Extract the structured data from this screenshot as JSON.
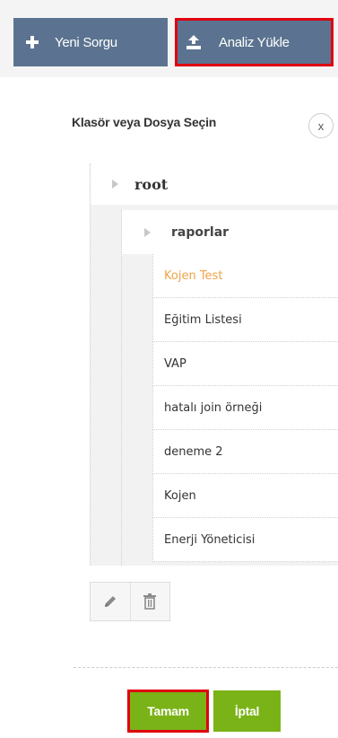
{
  "toolbar": {
    "new_query_label": "Yeni Sorgu",
    "upload_analysis_label": "Analiz Yükle"
  },
  "dialog": {
    "title": "Klasör veya Dosya Seçin",
    "close_label": "x"
  },
  "tree": {
    "root": {
      "label": "root"
    },
    "folder": {
      "label": "raporlar"
    },
    "files": [
      {
        "label": "Kojen Test",
        "selected": true
      },
      {
        "label": "Eğitim Listesi",
        "selected": false
      },
      {
        "label": "VAP",
        "selected": false
      },
      {
        "label": "hatalı join örneği",
        "selected": false
      },
      {
        "label": "deneme 2",
        "selected": false
      },
      {
        "label": "Kojen",
        "selected": false
      },
      {
        "label": "Enerji Yöneticisi",
        "selected": false
      }
    ]
  },
  "tools": {
    "edit_icon": "pencil-icon",
    "delete_icon": "trash-icon"
  },
  "footer": {
    "ok_label": "Tamam",
    "cancel_label": "İptal"
  },
  "colors": {
    "toolbar_button": "#5b7390",
    "highlight": "#e0000f",
    "selected_file": "#f0a347",
    "action_button": "#7ab317"
  }
}
